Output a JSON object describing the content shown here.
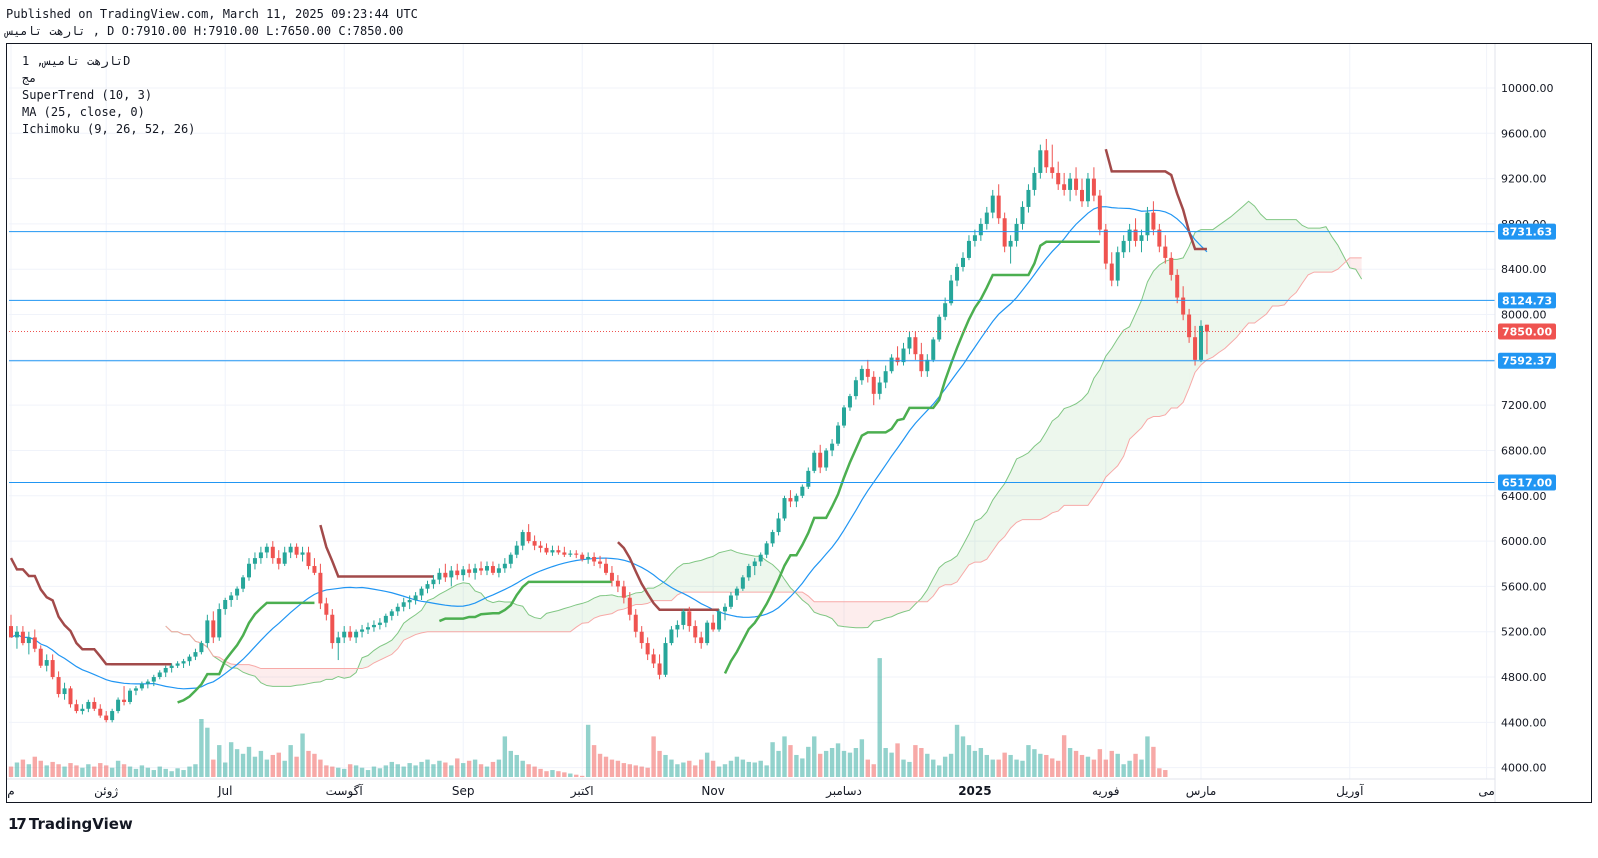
{
  "header": {
    "line1": "Published on TradingView.com, March 11, 2025 09:23:44 UTC",
    "line2": "تارهت  تاميس , D O:7910.00 H:7910.00 L:7650.00 C:7850.00"
  },
  "legend": {
    "symbol": "تارهت  تاميس, 1D",
    "sub": "مج",
    "ind1": "SuperTrend (10, 3)",
    "ind2": "MA (25, close, 0)",
    "ind3": "Ichimoku (9, 26, 52, 26)"
  },
  "footer": {
    "brand": "TradingView"
  },
  "colors": {
    "up": "#26a69a",
    "down": "#ef5350",
    "st_up": "#4caf50",
    "st_down": "#a24a4a",
    "ma": "#2196f3",
    "hline": "#2196f3",
    "cloud_green": "#4caf50",
    "cloud_red": "#ef5350"
  },
  "chart_data": {
    "type": "candlestick",
    "ylim": [
      3900,
      10300
    ],
    "y_ticks": [
      "10000.00",
      "9600.00",
      "9200.00",
      "8800.00",
      "8400.00",
      "8000.00",
      "7600.00",
      "7200.00",
      "6800.00",
      "6400.00",
      "6000.00",
      "5600.00",
      "5200.00",
      "4800.00",
      "4400.00",
      "4000.00"
    ],
    "x_labels": [
      {
        "label": "م",
        "t": 0
      },
      {
        "label": "ژوئن",
        "t": 16
      },
      {
        "label": "Jul",
        "t": 36
      },
      {
        "label": "آگوست",
        "t": 56
      },
      {
        "label": "Sep",
        "t": 76
      },
      {
        "label": "اکتبر",
        "t": 96
      },
      {
        "label": "Nov",
        "t": 118
      },
      {
        "label": "دسامبر",
        "t": 140
      },
      {
        "label": "2025",
        "t": 162
      },
      {
        "label": "فوریه",
        "t": 184
      },
      {
        "label": "مارس",
        "t": 200
      },
      {
        "label": "آوریل",
        "t": 225
      },
      {
        "label": "می",
        "t": 248
      }
    ],
    "hlines": [
      {
        "value": 8731.63,
        "label": "8731.63"
      },
      {
        "value": 8124.73,
        "label": "8124.73"
      },
      {
        "value": 7592.37,
        "label": "7592.37"
      },
      {
        "value": 6517.0,
        "label": "6517.00"
      }
    ],
    "last_price": {
      "value": 7850.0,
      "label": "7850.00"
    },
    "candles": [
      [
        5250,
        5350,
        5150,
        5150
      ],
      [
        5150,
        5250,
        5050,
        5200
      ],
      [
        5200,
        5250,
        5080,
        5100
      ],
      [
        5100,
        5200,
        5000,
        5150
      ],
      [
        5150,
        5220,
        5020,
        5050
      ],
      [
        5050,
        5080,
        4880,
        4900
      ],
      [
        4900,
        5000,
        4850,
        4950
      ],
      [
        4950,
        5000,
        4780,
        4800
      ],
      [
        4800,
        4850,
        4620,
        4650
      ],
      [
        4650,
        4750,
        4600,
        4700
      ],
      [
        4700,
        4720,
        4530,
        4560
      ],
      [
        4560,
        4600,
        4480,
        4500
      ],
      [
        4500,
        4560,
        4470,
        4520
      ],
      [
        4520,
        4600,
        4490,
        4580
      ],
      [
        4580,
        4620,
        4500,
        4520
      ],
      [
        4520,
        4560,
        4440,
        4460
      ],
      [
        4460,
        4500,
        4400,
        4420
      ],
      [
        4420,
        4520,
        4400,
        4500
      ],
      [
        4500,
        4620,
        4480,
        4600
      ],
      [
        4600,
        4720,
        4550,
        4580
      ],
      [
        4580,
        4700,
        4560,
        4680
      ],
      [
        4680,
        4720,
        4640,
        4700
      ],
      [
        4700,
        4760,
        4680,
        4740
      ],
      [
        4740,
        4780,
        4700,
        4760
      ],
      [
        4760,
        4820,
        4720,
        4800
      ],
      [
        4800,
        4860,
        4780,
        4840
      ],
      [
        4840,
        4900,
        4800,
        4880
      ],
      [
        4880,
        4920,
        4840,
        4900
      ],
      [
        4900,
        4940,
        4880,
        4920
      ],
      [
        4920,
        4960,
        4880,
        4940
      ],
      [
        4940,
        5000,
        4900,
        4980
      ],
      [
        4980,
        5050,
        4950,
        5020
      ],
      [
        5020,
        5120,
        5000,
        5100
      ],
      [
        5100,
        5350,
        5060,
        5300
      ],
      [
        5300,
        5380,
        5100,
        5150
      ],
      [
        5150,
        5450,
        5120,
        5400
      ],
      [
        5400,
        5500,
        5350,
        5480
      ],
      [
        5480,
        5550,
        5420,
        5520
      ],
      [
        5520,
        5600,
        5480,
        5580
      ],
      [
        5580,
        5700,
        5550,
        5680
      ],
      [
        5680,
        5850,
        5650,
        5800
      ],
      [
        5800,
        5900,
        5750,
        5850
      ],
      [
        5850,
        5950,
        5800,
        5900
      ],
      [
        5900,
        5980,
        5850,
        5950
      ],
      [
        5950,
        6000,
        5800,
        5850
      ],
      [
        5850,
        5920,
        5750,
        5800
      ],
      [
        5800,
        5950,
        5780,
        5900
      ],
      [
        5900,
        5980,
        5850,
        5950
      ],
      [
        5950,
        5980,
        5850,
        5880
      ],
      [
        5880,
        5950,
        5820,
        5900
      ],
      [
        5900,
        5950,
        5750,
        5780
      ],
      [
        5780,
        5850,
        5700,
        5720
      ],
      [
        5720,
        5800,
        5400,
        5450
      ],
      [
        5450,
        5500,
        5300,
        5350
      ],
      [
        5350,
        5400,
        5050,
        5100
      ],
      [
        5100,
        5200,
        4950,
        5150
      ],
      [
        5150,
        5250,
        5100,
        5200
      ],
      [
        5200,
        5250,
        5120,
        5150
      ],
      [
        5150,
        5220,
        5100,
        5200
      ],
      [
        5200,
        5260,
        5150,
        5220
      ],
      [
        5220,
        5280,
        5180,
        5240
      ],
      [
        5240,
        5300,
        5200,
        5260
      ],
      [
        5260,
        5320,
        5220,
        5280
      ],
      [
        5280,
        5360,
        5240,
        5340
      ],
      [
        5340,
        5400,
        5300,
        5380
      ],
      [
        5380,
        5450,
        5340,
        5420
      ],
      [
        5420,
        5500,
        5380,
        5460
      ],
      [
        5460,
        5520,
        5400,
        5480
      ],
      [
        5480,
        5550,
        5440,
        5520
      ],
      [
        5520,
        5600,
        5480,
        5580
      ],
      [
        5580,
        5650,
        5540,
        5620
      ],
      [
        5620,
        5700,
        5580,
        5660
      ],
      [
        5660,
        5760,
        5620,
        5720
      ],
      [
        5720,
        5800,
        5640,
        5680
      ],
      [
        5680,
        5780,
        5600,
        5740
      ],
      [
        5740,
        5800,
        5660,
        5700
      ],
      [
        5700,
        5780,
        5650,
        5750
      ],
      [
        5750,
        5800,
        5680,
        5720
      ],
      [
        5720,
        5800,
        5660,
        5760
      ],
      [
        5760,
        5820,
        5700,
        5740
      ],
      [
        5740,
        5820,
        5700,
        5780
      ],
      [
        5780,
        5820,
        5700,
        5720
      ],
      [
        5720,
        5800,
        5680,
        5760
      ],
      [
        5760,
        5850,
        5720,
        5800
      ],
      [
        5800,
        5900,
        5760,
        5880
      ],
      [
        5880,
        6000,
        5850,
        5960
      ],
      [
        5960,
        6100,
        5920,
        6080
      ],
      [
        6080,
        6150,
        5980,
        6000
      ],
      [
        6000,
        6050,
        5920,
        5960
      ],
      [
        5960,
        6000,
        5900,
        5940
      ],
      [
        5940,
        5980,
        5880,
        5900
      ],
      [
        5900,
        5960,
        5870,
        5920
      ],
      [
        5920,
        5960,
        5880,
        5900
      ],
      [
        5900,
        5950,
        5860,
        5880
      ],
      [
        5880,
        5920,
        5860,
        5890
      ],
      [
        5890,
        5920,
        5850,
        5880
      ],
      [
        5880,
        5900,
        5820,
        5840
      ],
      [
        5840,
        5900,
        5800,
        5860
      ],
      [
        5860,
        5900,
        5780,
        5820
      ],
      [
        5820,
        5870,
        5760,
        5800
      ],
      [
        5800,
        5850,
        5700,
        5720
      ],
      [
        5720,
        5780,
        5600,
        5650
      ],
      [
        5650,
        5700,
        5550,
        5600
      ],
      [
        5600,
        5650,
        5450,
        5500
      ],
      [
        5500,
        5550,
        5300,
        5350
      ],
      [
        5350,
        5400,
        5150,
        5200
      ],
      [
        5200,
        5250,
        5050,
        5100
      ],
      [
        5100,
        5150,
        4950,
        5000
      ],
      [
        5000,
        5050,
        4880,
        4920
      ],
      [
        4920,
        5000,
        4780,
        4820
      ],
      [
        4820,
        5150,
        4800,
        5100
      ],
      [
        5100,
        5250,
        5080,
        5220
      ],
      [
        5220,
        5300,
        5150,
        5260
      ],
      [
        5260,
        5400,
        5220,
        5380
      ],
      [
        5380,
        5420,
        5200,
        5250
      ],
      [
        5250,
        5300,
        5100,
        5150
      ],
      [
        5150,
        5200,
        5050,
        5100
      ],
      [
        5100,
        5300,
        5080,
        5280
      ],
      [
        5280,
        5350,
        5200,
        5220
      ],
      [
        5220,
        5400,
        5200,
        5380
      ],
      [
        5380,
        5450,
        5300,
        5420
      ],
      [
        5420,
        5550,
        5400,
        5520
      ],
      [
        5520,
        5600,
        5480,
        5580
      ],
      [
        5580,
        5700,
        5560,
        5680
      ],
      [
        5680,
        5800,
        5650,
        5780
      ],
      [
        5780,
        5850,
        5700,
        5820
      ],
      [
        5820,
        5900,
        5780,
        5880
      ],
      [
        5880,
        6000,
        5850,
        5980
      ],
      [
        5980,
        6100,
        5950,
        6080
      ],
      [
        6080,
        6250,
        6050,
        6200
      ],
      [
        6200,
        6400,
        6180,
        6380
      ],
      [
        6380,
        6450,
        6300,
        6350
      ],
      [
        6350,
        6420,
        6300,
        6400
      ],
      [
        6400,
        6500,
        6380,
        6480
      ],
      [
        6480,
        6650,
        6460,
        6620
      ],
      [
        6620,
        6800,
        6600,
        6780
      ],
      [
        6780,
        6850,
        6600,
        6650
      ],
      [
        6650,
        6820,
        6620,
        6800
      ],
      [
        6800,
        6900,
        6750,
        6860
      ],
      [
        6860,
        7050,
        6840,
        7020
      ],
      [
        7020,
        7200,
        7000,
        7180
      ],
      [
        7180,
        7300,
        7150,
        7280
      ],
      [
        7280,
        7450,
        7250,
        7420
      ],
      [
        7420,
        7550,
        7380,
        7520
      ],
      [
        7520,
        7600,
        7400,
        7450
      ],
      [
        7450,
        7500,
        7200,
        7300
      ],
      [
        7300,
        7450,
        7250,
        7400
      ],
      [
        7400,
        7550,
        7350,
        7500
      ],
      [
        7500,
        7650,
        7480,
        7620
      ],
      [
        7620,
        7720,
        7550,
        7580
      ],
      [
        7580,
        7750,
        7550,
        7700
      ],
      [
        7700,
        7850,
        7650,
        7800
      ],
      [
        7800,
        7850,
        7600,
        7650
      ],
      [
        7650,
        7750,
        7450,
        7500
      ],
      [
        7500,
        7650,
        7450,
        7600
      ],
      [
        7600,
        7800,
        7580,
        7780
      ],
      [
        7780,
        8000,
        7760,
        7980
      ],
      [
        7980,
        8150,
        7950,
        8100
      ],
      [
        8100,
        8350,
        8080,
        8300
      ],
      [
        8300,
        8450,
        8250,
        8420
      ],
      [
        8420,
        8550,
        8380,
        8500
      ],
      [
        8500,
        8700,
        8480,
        8650
      ],
      [
        8650,
        8750,
        8600,
        8700
      ],
      [
        8700,
        8850,
        8650,
        8800
      ],
      [
        8800,
        8950,
        8750,
        8900
      ],
      [
        8900,
        9100,
        8850,
        9050
      ],
      [
        9050,
        9150,
        8800,
        8850
      ],
      [
        8850,
        8900,
        8550,
        8600
      ],
      [
        8600,
        8700,
        8450,
        8650
      ],
      [
        8650,
        8850,
        8600,
        8800
      ],
      [
        8800,
        9000,
        8750,
        8950
      ],
      [
        8950,
        9150,
        8900,
        9100
      ],
      [
        9100,
        9300,
        9050,
        9250
      ],
      [
        9250,
        9500,
        9200,
        9450
      ],
      [
        9450,
        9550,
        9250,
        9300
      ],
      [
        9300,
        9500,
        9200,
        9250
      ],
      [
        9250,
        9350,
        9100,
        9150
      ],
      [
        9150,
        9250,
        9050,
        9100
      ],
      [
        9100,
        9250,
        9000,
        9200
      ],
      [
        9200,
        9300,
        9050,
        9100
      ],
      [
        9100,
        9200,
        8950,
        9000
      ],
      [
        9000,
        9250,
        8950,
        9200
      ],
      [
        9200,
        9300,
        9000,
        9050
      ],
      [
        9050,
        9100,
        8700,
        8750
      ],
      [
        8750,
        8800,
        8400,
        8450
      ],
      [
        8450,
        8550,
        8250,
        8300
      ],
      [
        8300,
        8600,
        8250,
        8550
      ],
      [
        8550,
        8700,
        8500,
        8650
      ],
      [
        8650,
        8800,
        8550,
        8750
      ],
      [
        8750,
        8850,
        8600,
        8650
      ],
      [
        8650,
        8750,
        8550,
        8700
      ],
      [
        8700,
        8950,
        8650,
        8900
      ],
      [
        8900,
        9000,
        8700,
        8750
      ],
      [
        8750,
        8800,
        8550,
        8600
      ],
      [
        8600,
        8700,
        8450,
        8500
      ],
      [
        8500,
        8550,
        8300,
        8350
      ],
      [
        8350,
        8400,
        8100,
        8150
      ],
      [
        8150,
        8250,
        7950,
        8000
      ],
      [
        8000,
        8050,
        7750,
        7800
      ],
      [
        7800,
        7900,
        7550,
        7600
      ],
      [
        7600,
        7950,
        7580,
        7900
      ],
      [
        7910,
        7910,
        7650,
        7850
      ]
    ],
    "volumes": [
      0.18,
      0.25,
      0.3,
      0.22,
      0.35,
      0.28,
      0.2,
      0.26,
      0.22,
      0.18,
      0.24,
      0.2,
      0.16,
      0.22,
      0.18,
      0.24,
      0.2,
      0.16,
      0.28,
      0.22,
      0.18,
      0.14,
      0.2,
      0.16,
      0.12,
      0.18,
      0.14,
      0.1,
      0.15,
      0.12,
      0.18,
      0.22,
      1.0,
      0.85,
      0.3,
      0.55,
      0.25,
      0.6,
      0.48,
      0.4,
      0.52,
      0.35,
      0.45,
      0.3,
      0.38,
      0.42,
      0.28,
      0.55,
      0.35,
      0.75,
      0.45,
      0.4,
      0.3,
      0.2,
      0.18,
      0.16,
      0.14,
      0.22,
      0.2,
      0.16,
      0.12,
      0.18,
      0.15,
      0.2,
      0.26,
      0.22,
      0.18,
      0.24,
      0.2,
      0.26,
      0.3,
      0.22,
      0.28,
      0.25,
      0.2,
      0.32,
      0.24,
      0.28,
      0.3,
      0.22,
      0.18,
      0.26,
      0.3,
      0.7,
      0.45,
      0.38,
      0.28,
      0.22,
      0.18,
      0.14,
      0.1,
      0.12,
      0.1,
      0.08,
      0.06,
      0.04,
      0.02,
      0.9,
      0.55,
      0.4,
      0.35,
      0.3,
      0.28,
      0.24,
      0.22,
      0.2,
      0.18,
      0.16,
      0.7,
      0.45,
      0.38,
      0.3,
      0.22,
      0.25,
      0.28,
      0.2,
      0.3,
      0.42,
      0.28,
      0.18,
      0.22,
      0.28,
      0.35,
      0.3,
      0.26,
      0.25,
      0.28,
      0.2,
      0.6,
      0.45,
      0.7,
      0.55,
      0.38,
      0.32,
      0.52,
      0.7,
      0.4,
      0.45,
      0.5,
      0.58,
      0.45,
      0.42,
      0.5,
      0.65,
      0.3,
      0.22,
      2.05,
      0.5,
      0.42,
      0.58,
      0.3,
      0.26,
      0.55,
      0.5,
      0.4,
      0.3,
      0.2,
      0.35,
      0.4,
      0.9,
      0.7,
      0.55,
      0.45,
      0.5,
      0.38,
      0.3,
      0.3,
      0.42,
      0.38,
      0.3,
      0.28,
      0.55,
      0.48,
      0.4,
      0.38,
      0.32,
      0.28,
      0.72,
      0.5,
      0.45,
      0.38,
      0.35,
      0.3,
      0.48,
      0.3,
      0.45,
      0.4,
      0.22,
      0.28,
      0.4,
      0.3,
      0.7,
      0.52,
      0.15,
      0.12
    ],
    "tenkan": [],
    "supertrend_note": "computed"
  }
}
